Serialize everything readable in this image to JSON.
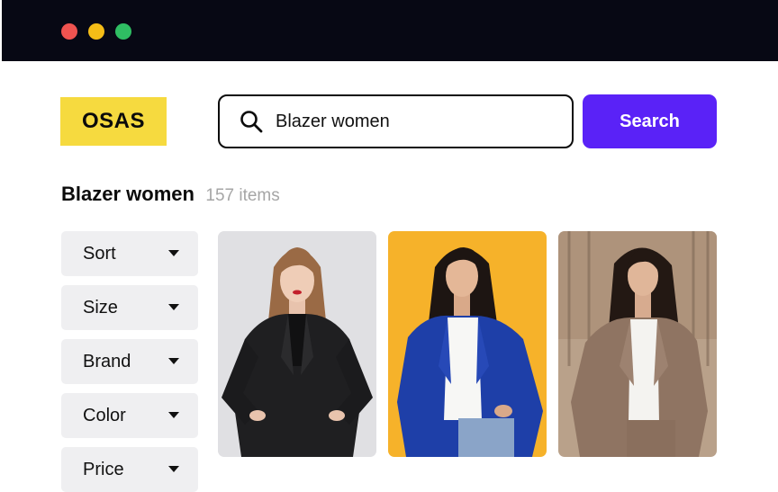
{
  "window": {
    "controls": [
      {
        "name": "close",
        "color": "#ef5350"
      },
      {
        "name": "minimize",
        "color": "#f5bd17"
      },
      {
        "name": "maximize",
        "color": "#2fbe63"
      }
    ]
  },
  "header": {
    "logo_text": "OSAS",
    "search": {
      "value": "Blazer women",
      "icon": "search-icon"
    },
    "search_button_label": "Search"
  },
  "results": {
    "query": "Blazer women",
    "count": "157 items"
  },
  "filters": [
    {
      "label": "Sort",
      "icon": "caret-down-icon"
    },
    {
      "label": "Size",
      "icon": "caret-down-icon"
    },
    {
      "label": "Brand",
      "icon": "caret-down-icon"
    },
    {
      "label": "Color",
      "icon": "caret-down-icon"
    },
    {
      "label": "Price",
      "icon": "caret-down-icon"
    }
  ],
  "products": [
    {
      "image": "woman-in-black-blazer-photo",
      "background": "#e6e6e8"
    },
    {
      "image": "woman-in-blue-blazer-photo",
      "background": "#f7b52c"
    },
    {
      "image": "woman-in-beige-blazer-photo",
      "background": "#b79d84"
    }
  ],
  "colors": {
    "accent": "#5a22f7",
    "logo_background": "#f6da3f",
    "titlebar": "#070814"
  }
}
